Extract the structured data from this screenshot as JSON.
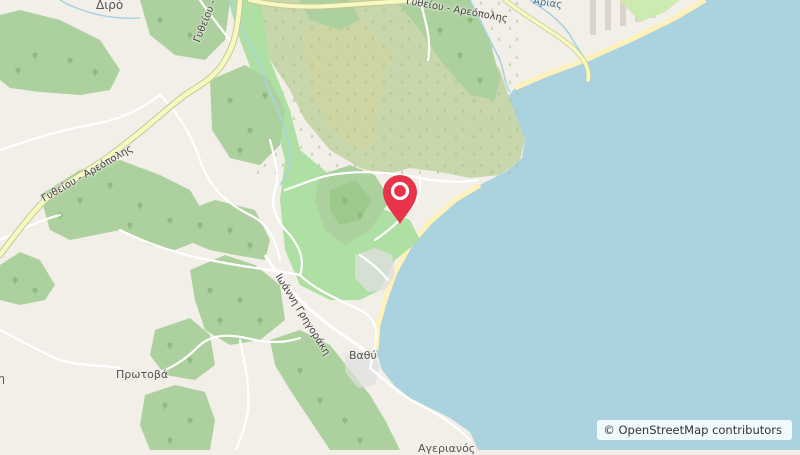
{
  "map": {
    "labels": {
      "diro": "Διρό",
      "road_gythio_areopoli_1": "Γυθείου - Αρεόπολης",
      "road_gythio_areopoli_2": "Γυθείου - Αρεόπολης",
      "road_gythio_areopoli_3": "Γυθείου - Αρεόπολης",
      "road_ioanni_grigoraki": "Ιωάννη Γρηγοράκη",
      "vathy": "Βαθύ",
      "protova": "Πρωτοβά",
      "agerianos": "Αγεριανός",
      "top_right_partial": "Αρίας",
      "left_edge_partial": "η"
    },
    "attribution": "© OpenStreetMap contributors",
    "marker_icon": "map-pin-icon",
    "colors": {
      "sea": "#aad3df",
      "land": "#f2efe9",
      "forest": "#add19e",
      "scrub": "#c8d7ab",
      "beach": "#fff1ba",
      "road_major": "#f7fabf",
      "road_minor": "#ffffff",
      "marker": "#e8334a"
    }
  }
}
